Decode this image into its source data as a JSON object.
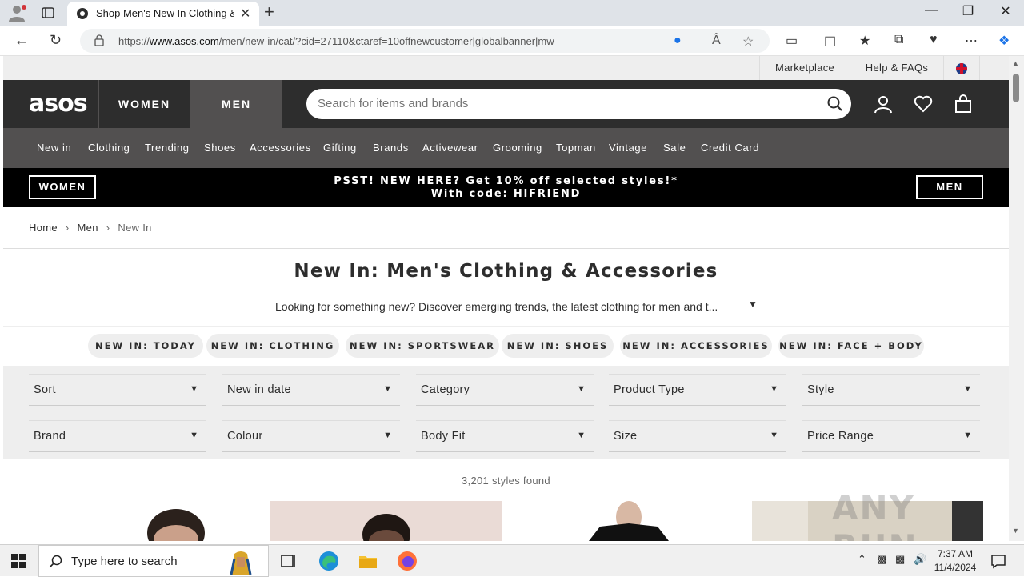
{
  "browser": {
    "tab_title": "Shop Men's New In Clothing & Accessories | ASOS",
    "url_prefix": "https://",
    "url_domain": "www.asos.com",
    "url_path": "/men/new-in/cat/?cid=27110&ctaref=10offnewcustomer|globalbanner|mw",
    "new_tab": "+",
    "close_tab": "✕",
    "win_min": "—",
    "win_restore": "❐",
    "win_close": "✕"
  },
  "utility": {
    "marketplace": "Marketplace",
    "help": "Help & FAQs"
  },
  "header": {
    "logo": "asos",
    "women": "WOMEN",
    "men": "MEN",
    "search_placeholder": "Search for items and brands"
  },
  "categories": [
    "New in",
    "Clothing",
    "Trending",
    "Shoes",
    "Accessories",
    "Gifting",
    "Brands",
    "Activewear",
    "Grooming",
    "Topman",
    "Vintage",
    "Sale",
    "Credit Card"
  ],
  "promo": {
    "women_btn": "WOMEN",
    "men_btn": "MEN",
    "line1": "PSST! NEW HERE? Get 10% off selected styles!*",
    "line2": "With code: HIFRIEND"
  },
  "breadcrumb": {
    "home": "Home",
    "men": "Men",
    "current": "New In",
    "sep": "›"
  },
  "page": {
    "title": "New In: Men's Clothing & Accessories",
    "description": "Looking for something new? Discover emerging trends, the latest clothing for men and t...",
    "count": "3,201 styles found"
  },
  "pills": [
    "NEW IN: TODAY",
    "NEW IN: CLOTHING",
    "NEW IN: SPORTSWEAR",
    "NEW IN: SHOES",
    "NEW IN: ACCESSORIES",
    "NEW IN: FACE + BODY"
  ],
  "filters_row1": [
    "Sort",
    "New in date",
    "Category",
    "Product Type",
    "Style"
  ],
  "filters_row2": [
    "Brand",
    "Colour",
    "Body Fit",
    "Size",
    "Price Range"
  ],
  "watermark": "ANY RUN",
  "taskbar": {
    "search_placeholder": "Type here to search",
    "time": "7:37 AM",
    "date": "11/4/2024"
  },
  "colors": {
    "header_bg": "#2d2d2d",
    "category_bg": "#525050",
    "promo_bg": "#000000",
    "pill_bg": "#eeeeee"
  }
}
